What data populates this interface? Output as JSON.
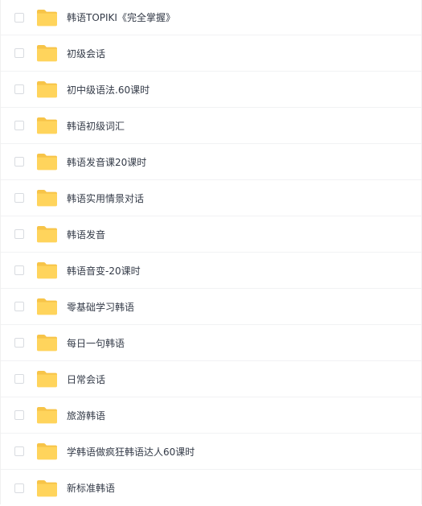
{
  "file_list": {
    "folder_icon": "folder-icon",
    "folder_color": "#ffd45c",
    "folder_tab_color": "#f7c448",
    "items": [
      {
        "name": "韩语TOPIKI《完全掌握》"
      },
      {
        "name": "初级会话"
      },
      {
        "name": "初中级语法.60课时"
      },
      {
        "name": "韩语初级词汇"
      },
      {
        "name": "韩语发音课20课时"
      },
      {
        "name": "韩语实用情景对话"
      },
      {
        "name": "韩语发音"
      },
      {
        "name": "韩语音变-20课时"
      },
      {
        "name": "零基础学习韩语"
      },
      {
        "name": "每日一句韩语"
      },
      {
        "name": "日常会话"
      },
      {
        "name": "旅游韩语"
      },
      {
        "name": "学韩语做疯狂韩语达人60课时"
      },
      {
        "name": "新标准韩语"
      }
    ]
  }
}
